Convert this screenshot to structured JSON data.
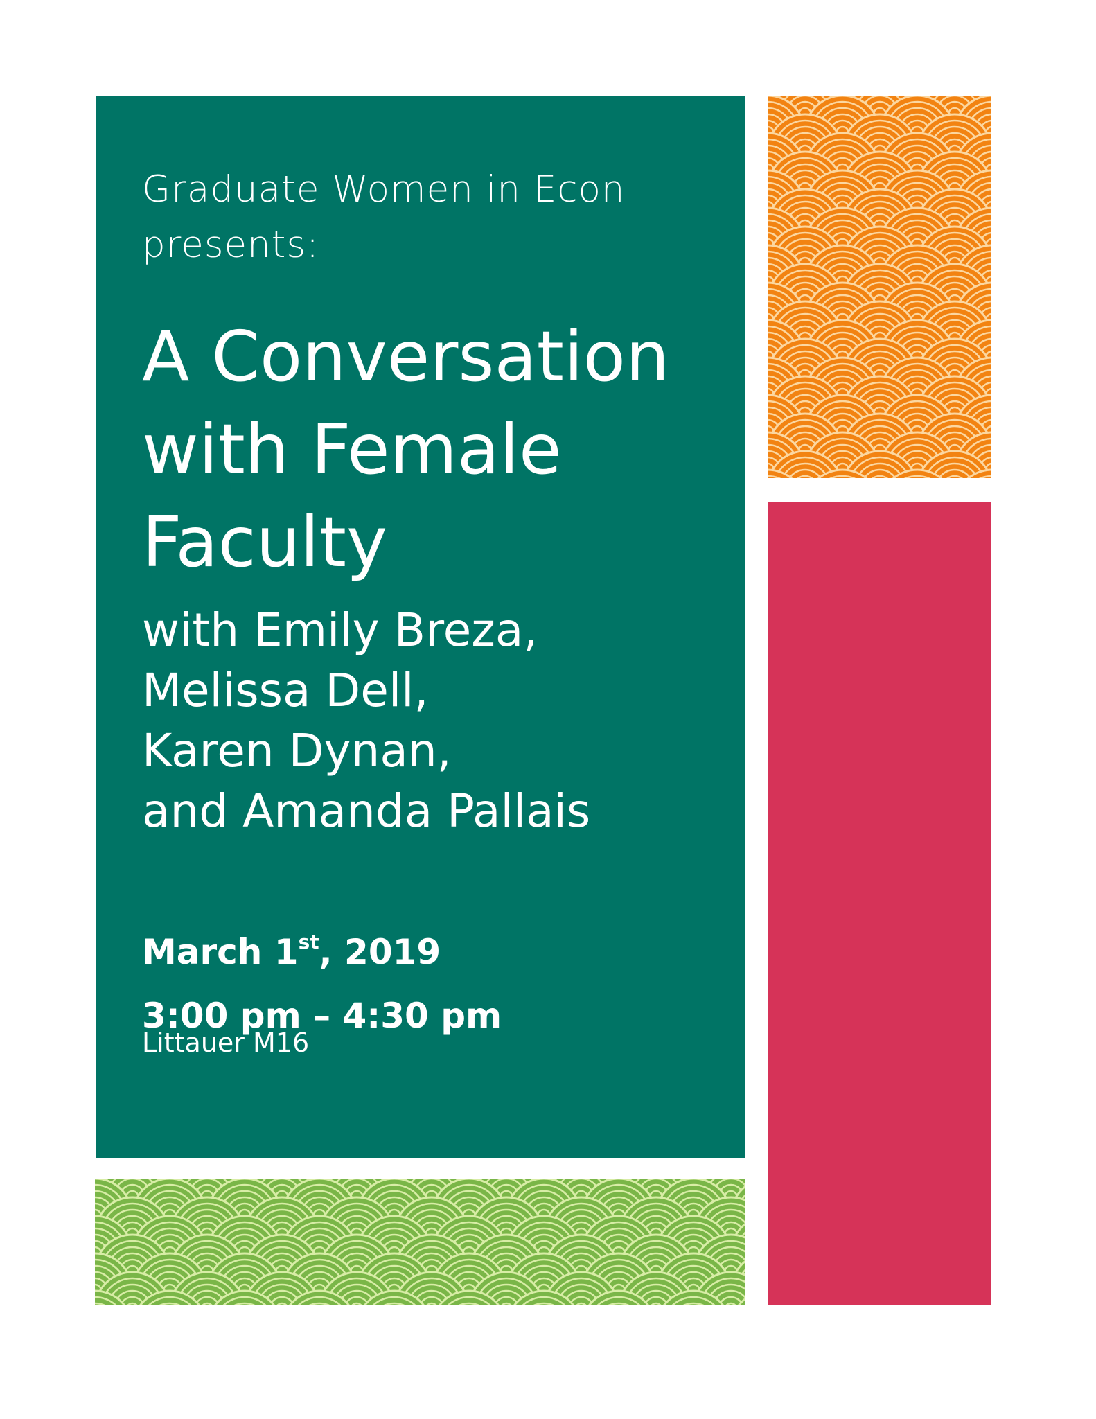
{
  "intro": [
    "Graduate Women in Econ",
    "presents:"
  ],
  "title": [
    "A Conversation",
    "with Female",
    "Faculty"
  ],
  "speakers": [
    "with Emily Breza,",
    "Melissa Dell,",
    "Karen Dynan,",
    "and Amanda Pallais"
  ],
  "date": {
    "month_day": "March 1",
    "suffix": "st",
    "year": ", 2019"
  },
  "time": "3:00 pm – 4:30 pm",
  "location": "Littauer M16",
  "colors": {
    "teal": "#007465",
    "orange": "#f28312",
    "orange_lines": "#fcd7a0",
    "pink": "#d63358",
    "green": "#7ab648",
    "green_lines": "#d8eda6"
  }
}
